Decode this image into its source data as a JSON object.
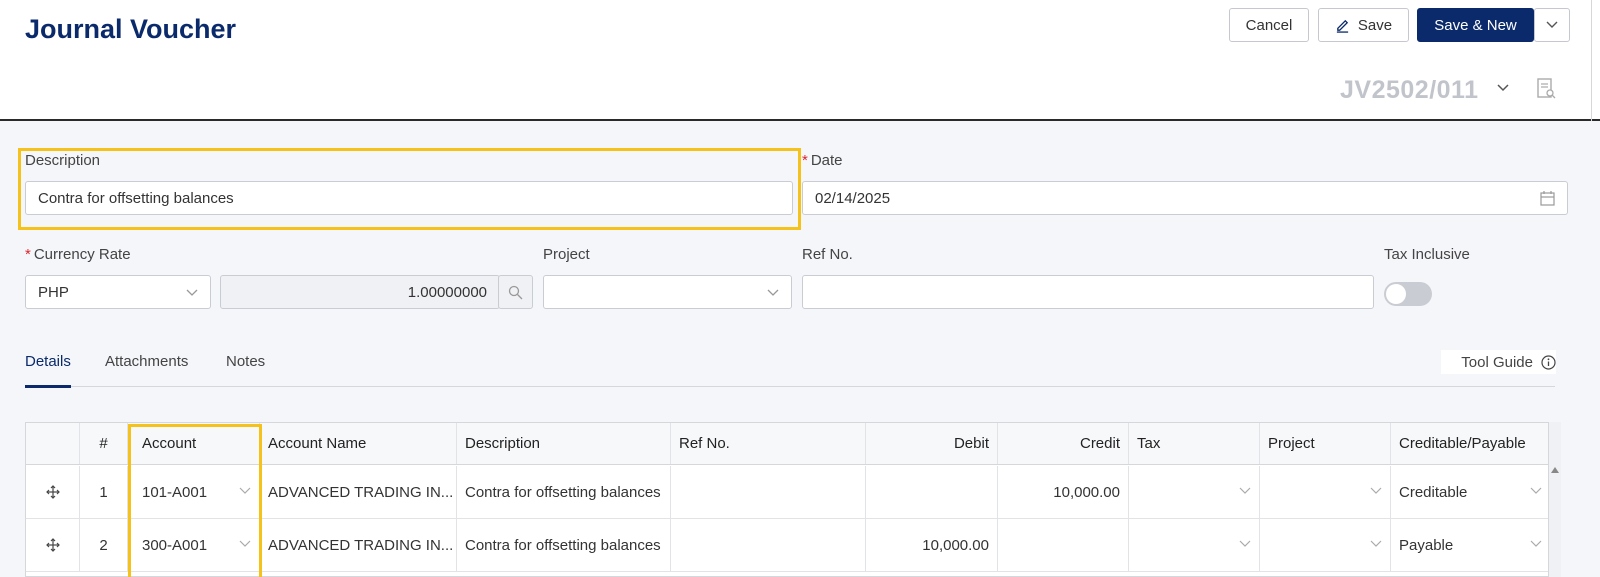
{
  "header": {
    "title": "Journal Voucher",
    "cancel_label": "Cancel",
    "save_label": "Save",
    "save_new_label": "Save & New",
    "doc_number": "JV2502/011"
  },
  "form": {
    "description": {
      "label": "Description",
      "value": "Contra for offsetting balances"
    },
    "date": {
      "label": "Date",
      "value": "02/14/2025",
      "required_mark": "*"
    },
    "currency_rate": {
      "label": "Currency Rate",
      "required_mark": "*",
      "currency": "PHP",
      "rate": "1.00000000"
    },
    "project": {
      "label": "Project",
      "value": ""
    },
    "ref_no": {
      "label": "Ref No.",
      "value": ""
    },
    "tax_inclusive": {
      "label": "Tax Inclusive",
      "enabled": false
    }
  },
  "tabs": [
    {
      "label": "Details",
      "active": true
    },
    {
      "label": "Attachments",
      "active": false
    },
    {
      "label": "Notes",
      "active": false
    }
  ],
  "tool_guide_label": "Tool Guide",
  "grid": {
    "columns": [
      "#",
      "Account",
      "Account Name",
      "Description",
      "Ref No.",
      "Debit",
      "Credit",
      "Tax",
      "Project",
      "Creditable/Payable"
    ],
    "rows": [
      {
        "no": "1",
        "account": "101-A001",
        "account_name": "ADVANCED TRADING IN...",
        "description": "Contra for offsetting balances",
        "ref_no": "",
        "debit": "",
        "credit": "10,000.00",
        "tax": "",
        "project": "",
        "cp": "Creditable"
      },
      {
        "no": "2",
        "account": "300-A001",
        "account_name": "ADVANCED TRADING IN...",
        "description": "Contra for offsetting balances",
        "ref_no": "",
        "debit": "10,000.00",
        "credit": "",
        "tax": "",
        "project": "",
        "cp": "Payable"
      }
    ]
  },
  "colors": {
    "primary": "#0b2a6b",
    "highlight": "#f4c21b",
    "required": "#d9262e"
  }
}
